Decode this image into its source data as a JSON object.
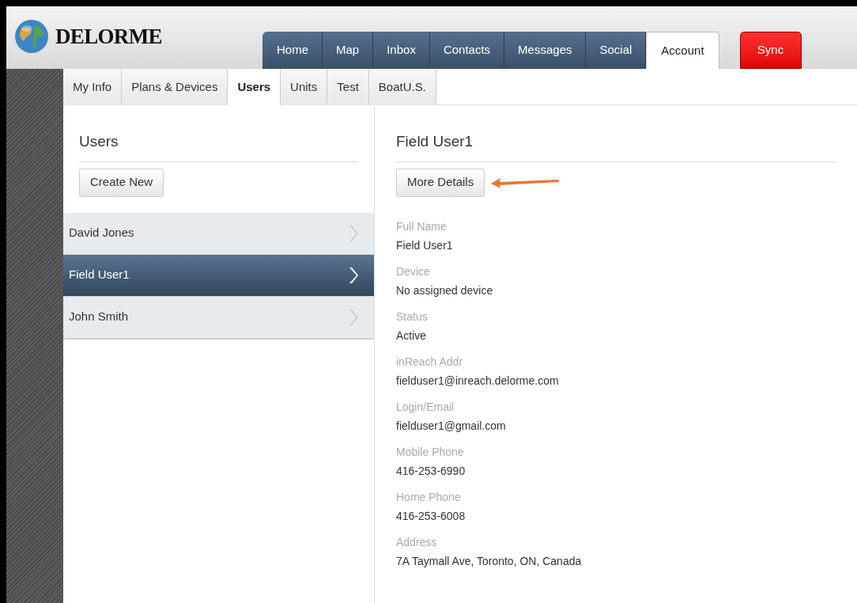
{
  "logo": {
    "text": "DELORME"
  },
  "main_tabs": [
    {
      "label": "Home",
      "selected": false,
      "kind": "nav"
    },
    {
      "label": "Map",
      "selected": false,
      "kind": "nav"
    },
    {
      "label": "Inbox",
      "selected": false,
      "kind": "nav"
    },
    {
      "label": "Contacts",
      "selected": false,
      "kind": "nav"
    },
    {
      "label": "Messages",
      "selected": false,
      "kind": "nav"
    },
    {
      "label": "Social",
      "selected": false,
      "kind": "nav"
    },
    {
      "label": "Account",
      "selected": true,
      "kind": "nav"
    },
    {
      "label": "Sync",
      "selected": false,
      "kind": "action"
    }
  ],
  "sub_tabs": [
    {
      "label": "My Info",
      "selected": false
    },
    {
      "label": "Plans & Devices",
      "selected": false
    },
    {
      "label": "Users",
      "selected": true
    },
    {
      "label": "Units",
      "selected": false
    },
    {
      "label": "Test",
      "selected": false
    },
    {
      "label": "BoatU.S.",
      "selected": false
    }
  ],
  "users_panel": {
    "title": "Users",
    "button": "Create New",
    "items": [
      {
        "name": "David Jones",
        "selected": false
      },
      {
        "name": "Field User1",
        "selected": true
      },
      {
        "name": "John Smith",
        "selected": false
      }
    ]
  },
  "details_panel": {
    "title": "Field User1",
    "button": "More Details",
    "fields": [
      {
        "label": "Full Name",
        "value": "Field User1"
      },
      {
        "label": "Device",
        "value": "No assigned device"
      },
      {
        "label": "Status",
        "value": "Active"
      },
      {
        "label": "inReach Addr",
        "value": "fielduser1@inreach.delorme.com"
      },
      {
        "label": "Login/Email",
        "value": "fielduser1@gmail.com"
      },
      {
        "label": "Mobile Phone",
        "value": "416-253-6990"
      },
      {
        "label": "Home Phone",
        "value": "416-253-6008"
      },
      {
        "label": "Address",
        "value": "7A Taymall Ave, Toronto, ON, Canada"
      }
    ]
  }
}
